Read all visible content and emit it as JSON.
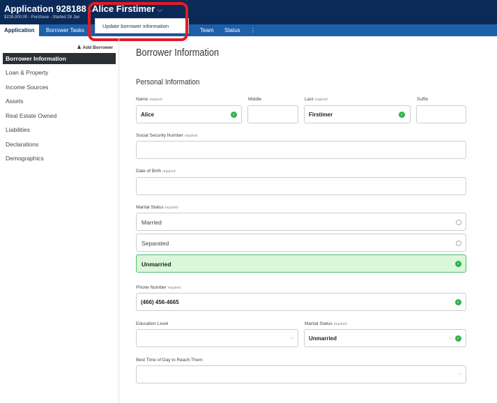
{
  "header": {
    "app_title": "Application 928188",
    "app_subtitle": "$228,000.00 - Purchase - Started 28 Jan",
    "user_name": "Alice Firstimer",
    "chevron": "⌵"
  },
  "user_menu": {
    "item": "Update borrower information"
  },
  "nav": {
    "tabs": [
      "Application",
      "Borrower Tasks",
      "Team",
      "Status",
      "⋮"
    ]
  },
  "sidebar": {
    "add_borrower": "Add Borrower",
    "items": [
      "Borrower Information",
      "Loan & Property",
      "Income Sources",
      "Assets",
      "Real Estate Owned",
      "Liabilities",
      "Declarations",
      "Demographics"
    ]
  },
  "main": {
    "title": "Borrower Information",
    "section": "Personal Information",
    "required_tag": "required",
    "name": {
      "label": "Name",
      "value": "Alice"
    },
    "middle": {
      "label": "Middle",
      "value": ""
    },
    "last": {
      "label": "Last",
      "value": "Firstimer"
    },
    "suffix": {
      "label": "Suffix",
      "value": ""
    },
    "ssn": {
      "label": "Social Security Number",
      "value": ""
    },
    "dob": {
      "label": "Date of Birth",
      "value": ""
    },
    "marital": {
      "label": "Marital Status",
      "options": [
        "Married",
        "Separated",
        "Unmarried"
      ],
      "selected": "Unmarried"
    },
    "phone": {
      "label": "Phone Number",
      "value": "(466) 456-4665"
    },
    "education": {
      "label": "Education Level",
      "value": ""
    },
    "marital2": {
      "label": "Marital Status",
      "value": "Unmarried"
    },
    "best_time": {
      "label": "Best Time of Day to Reach Them",
      "value": ""
    }
  },
  "colors": {
    "top_bar": "#0b2a57",
    "nav_bar": "#1e5faa",
    "highlight_box": "#e31b23",
    "selected_option_bg": "#d9f7d9",
    "check_green": "#2eb24a"
  }
}
